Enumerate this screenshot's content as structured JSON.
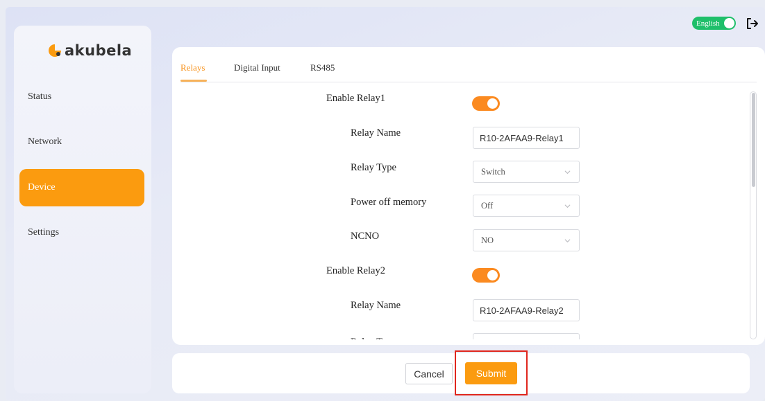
{
  "header": {
    "language_label": "English",
    "logout_icon": "logout-icon"
  },
  "brand": {
    "name": "akubela",
    "accent_color": "#fb9b0f"
  },
  "sidebar": {
    "items": [
      {
        "label": "Status",
        "active": false
      },
      {
        "label": "Network",
        "active": false
      },
      {
        "label": "Device",
        "active": true
      },
      {
        "label": "Settings",
        "active": false
      }
    ]
  },
  "tabs": [
    {
      "label": "Relays",
      "active": true
    },
    {
      "label": "Digital Input",
      "active": false
    },
    {
      "label": "RS485",
      "active": false
    }
  ],
  "relay1": {
    "enable_label": "Enable Relay1",
    "enabled": true,
    "name_label": "Relay Name",
    "name_value": "R10-2AFAA9-Relay1",
    "type_label": "Relay Type",
    "type_value": "Switch",
    "memory_label": "Power off memory",
    "memory_value": "Off",
    "ncno_label": "NCNO",
    "ncno_value": "NO"
  },
  "relay2": {
    "enable_label": "Enable Relay2",
    "enabled": true,
    "name_label": "Relay Name",
    "name_value": "R10-2AFAA9-Relay2",
    "type_label": "Relay Type"
  },
  "footer": {
    "cancel_label": "Cancel",
    "submit_label": "Submit"
  }
}
